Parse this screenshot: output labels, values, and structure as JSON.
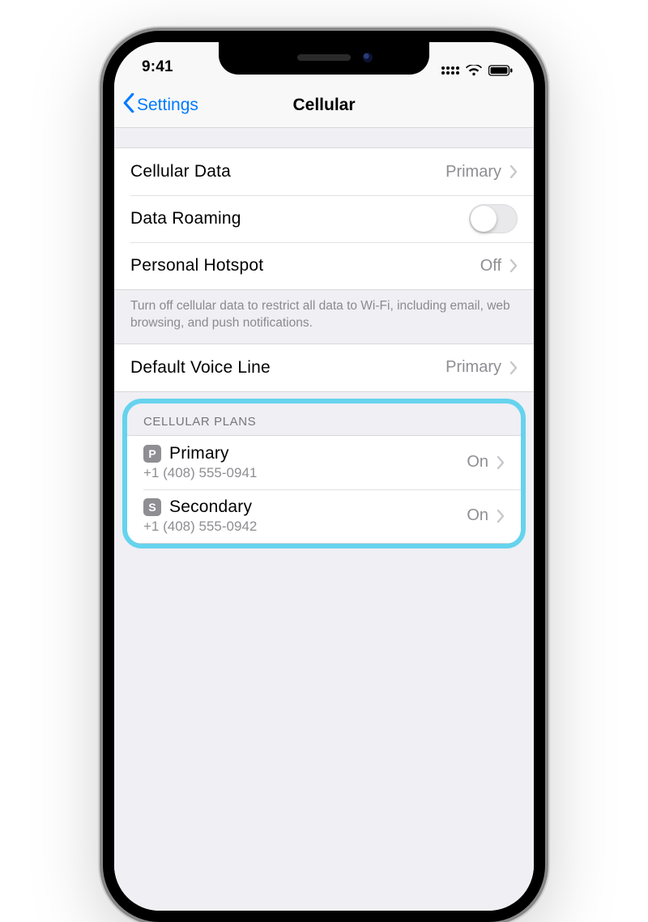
{
  "status": {
    "time": "9:41"
  },
  "nav": {
    "back_label": "Settings",
    "title": "Cellular"
  },
  "rows": {
    "cellular_data": {
      "label": "Cellular Data",
      "value": "Primary"
    },
    "data_roaming": {
      "label": "Data Roaming",
      "on": false
    },
    "personal_hotspot": {
      "label": "Personal Hotspot",
      "value": "Off"
    },
    "footer": "Turn off cellular data to restrict all data to Wi-Fi, including email, web browsing, and push notifications.",
    "default_voice": {
      "label": "Default Voice Line",
      "value": "Primary"
    }
  },
  "plans_section": {
    "header": "CELLULAR PLANS"
  },
  "plans": [
    {
      "badge": "P",
      "title": "Primary",
      "number": "+1 (408) 555-0941",
      "status": "On"
    },
    {
      "badge": "S",
      "title": "Secondary",
      "number": "+1 (408) 555-0942",
      "status": "On"
    }
  ]
}
